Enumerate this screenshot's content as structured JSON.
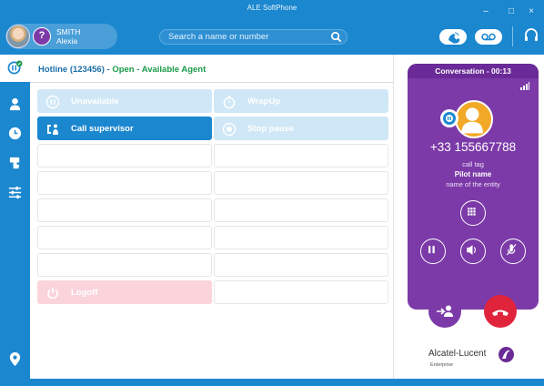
{
  "titlebar": {
    "app_title": "ALE SoftPhone",
    "minimize": "–",
    "maximize": "□",
    "close": "×"
  },
  "user": {
    "last_name": "SMITH",
    "first_name": "Alexia"
  },
  "search": {
    "placeholder": "Search a name or number"
  },
  "hotline": {
    "name": "Hotline (123456)",
    "sep1": " - ",
    "state": "Open",
    "sep2": " - ",
    "status": "Available Agent"
  },
  "actions": [
    {
      "label": "Unavailable",
      "style": "light",
      "icon": "pause-circle-icon"
    },
    {
      "label": "WrapUp",
      "style": "light",
      "icon": "timer-icon"
    },
    {
      "label": "Call supervisor",
      "style": "active",
      "icon": "supervisor-icon"
    },
    {
      "label": "Stop pause",
      "style": "light",
      "icon": "stop-circle-icon"
    },
    {
      "label": "Logoff",
      "style": "logoff",
      "icon": "power-icon"
    }
  ],
  "conversation": {
    "header": "Conversation - 00:13",
    "number": "+33 155667788",
    "tag": "call tag",
    "pilot": "Pilot name",
    "entity": "name of the entity"
  },
  "branding": {
    "name": "Alcatel-Lucent",
    "sub": "Enterprise"
  },
  "colors": {
    "primary": "#1b87cf",
    "conversation": "#7c3aa8",
    "hangup": "#e0243c",
    "available": "#1a9a4a"
  }
}
